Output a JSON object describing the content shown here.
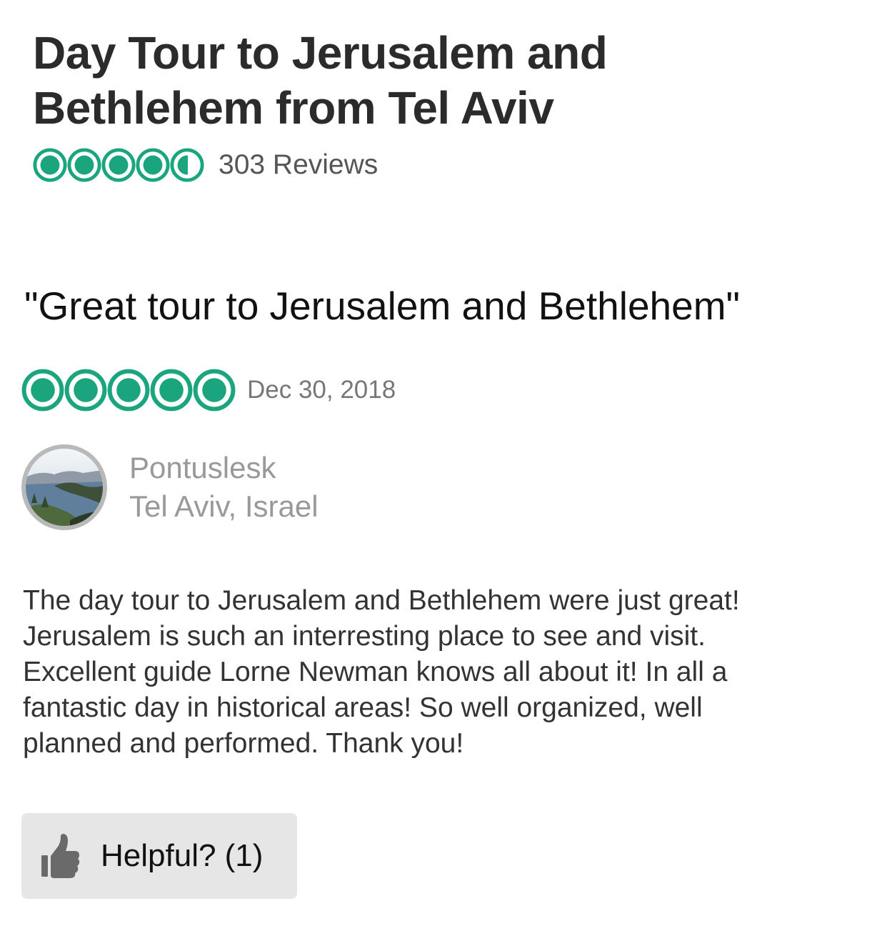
{
  "colors": {
    "bubble_green": "#1ba57f",
    "title_text": "#2b2b2b",
    "muted_text": "#999999",
    "button_bg": "#e6e6e6"
  },
  "product": {
    "title_lines": [
      "Day Tour to Jerusalem and",
      "Bethlehem from Tel Aviv"
    ],
    "rating": 4.5,
    "reviews_label": "303 Reviews"
  },
  "review": {
    "title": "\"Great tour to Jerusalem and Bethlehem\"",
    "rating": 5,
    "date": "Dec 30, 2018",
    "author": {
      "name": "Pontuslesk",
      "location": "Tel Aviv, Israel",
      "avatar_icon": "lake-landscape-avatar"
    },
    "body_lines": [
      "The day tour to Jerusalem and Bethlehem were just great!",
      "Jerusalem is such an interresting place to see and visit.",
      "Excellent guide Lorne Newman knows all about it! In all a",
      "fantastic day in historical areas! So well organized, well",
      "planned and performed. Thank you!"
    ]
  },
  "helpful": {
    "label": "Helpful? (1)",
    "icon": "thumbs-up-icon"
  }
}
